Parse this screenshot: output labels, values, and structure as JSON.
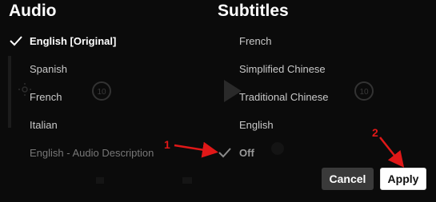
{
  "audio": {
    "title": "Audio",
    "items": [
      {
        "label": "English [Original]",
        "selected": true
      },
      {
        "label": "Spanish",
        "selected": false
      },
      {
        "label": "French",
        "selected": false
      },
      {
        "label": "Italian",
        "selected": false
      },
      {
        "label": "English - Audio Description",
        "selected": false
      }
    ]
  },
  "subtitles": {
    "title": "Subtitles",
    "items": [
      {
        "label": "French",
        "selected": false
      },
      {
        "label": "Simplified Chinese",
        "selected": false
      },
      {
        "label": "Traditional Chinese",
        "selected": false
      },
      {
        "label": "English",
        "selected": false
      },
      {
        "label": "Off",
        "selected": true
      }
    ]
  },
  "buttons": {
    "cancel_label": "Cancel",
    "apply_label": "Apply"
  },
  "annotations": {
    "step1": "1",
    "step2": "2"
  },
  "background": {
    "rewind_label": "10",
    "forward_label": "10"
  },
  "colors": {
    "annotation": "#e01818",
    "panel": "#0b0b0b"
  }
}
